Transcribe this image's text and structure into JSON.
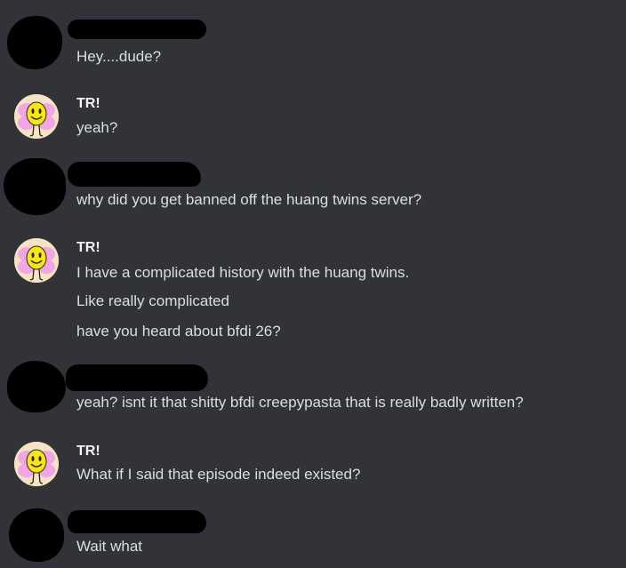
{
  "messages": [
    {
      "author": "",
      "lines": [
        "Hey....dude?"
      ]
    },
    {
      "author": "TR!",
      "lines": [
        "yeah?"
      ]
    },
    {
      "author": "",
      "lines": [
        "why did you get banned off the huang twins server?"
      ]
    },
    {
      "author": "TR!",
      "lines": [
        "I have a complicated history with the huang twins.",
        "Like really complicated",
        "have you heard about bfdi 26?"
      ]
    },
    {
      "author": "",
      "lines": [
        "yeah? isnt it that shitty bfdi creepypasta that is really badly written?"
      ]
    },
    {
      "author": "TR!",
      "lines": [
        "What if I said that episode indeed existed?"
      ]
    },
    {
      "author": "",
      "lines": [
        "Wait what"
      ]
    }
  ]
}
